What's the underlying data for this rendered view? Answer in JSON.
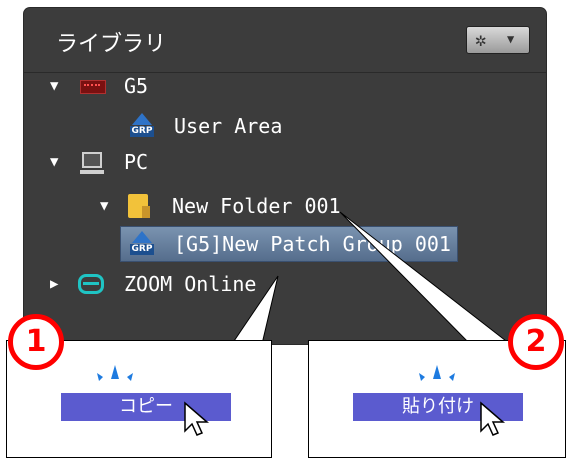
{
  "library": {
    "title": "ライブラリ",
    "settings_icon": "gear-icon",
    "items": [
      {
        "label": "G5",
        "icon": "g5-device-icon",
        "expanded": true
      },
      {
        "label": "User Area",
        "icon": "grp-icon"
      },
      {
        "label": "PC",
        "icon": "pc-monitor-icon",
        "expanded": true
      },
      {
        "label": "New Folder 001",
        "icon": "folder-icon",
        "expanded": true
      },
      {
        "label": "[G5]New Patch Group 001",
        "icon": "grp-icon",
        "selected": true
      },
      {
        "label": "ZOOM Online",
        "icon": "zoom-online-icon",
        "expanded": false
      }
    ],
    "grp_icon_text": "GRP"
  },
  "callouts": [
    {
      "step": "1",
      "menu_label": "コピー"
    },
    {
      "step": "2",
      "menu_label": "貼り付け"
    }
  ],
  "colors": {
    "panel_bg": "#3c3c3c",
    "selection": "#6a84a3",
    "badge_red": "#ff0000",
    "menu_highlight": "#5b5bcf",
    "sparkle_blue": "#1e7be0"
  }
}
